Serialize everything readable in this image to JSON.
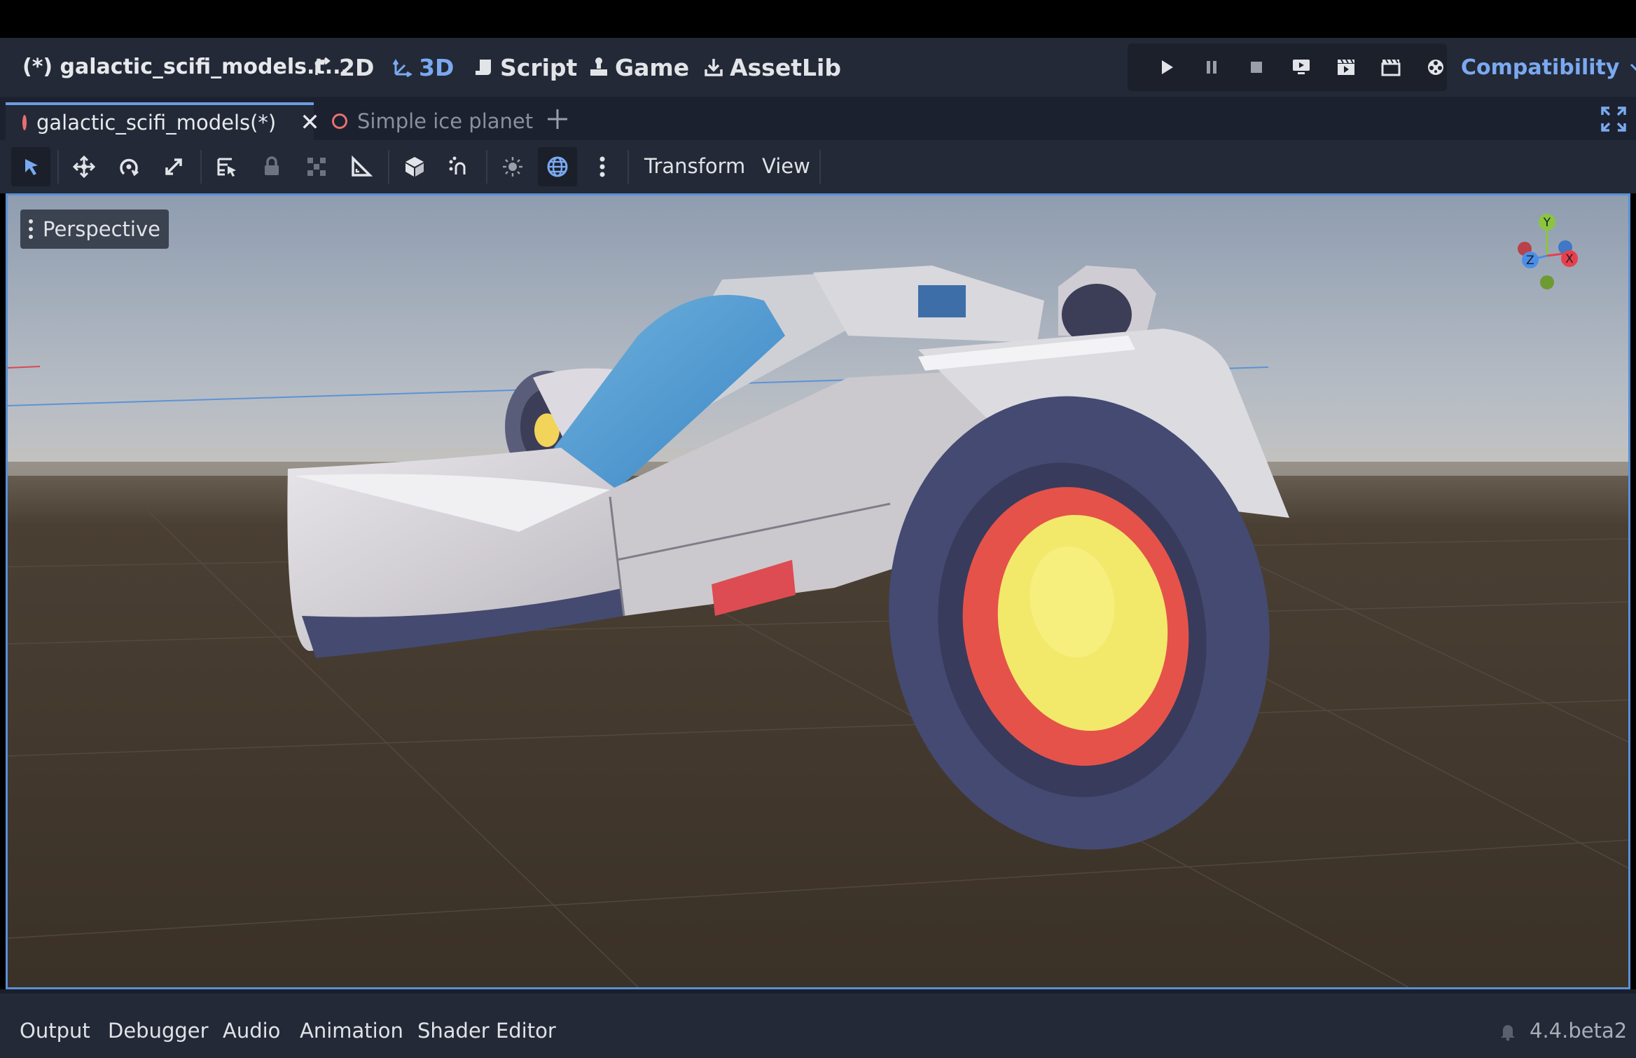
{
  "topbar": {
    "project_title": "(*) galactic_scifi_models.t...",
    "workspaces": [
      {
        "label": "2D",
        "icon": "2d-icon",
        "active": false
      },
      {
        "label": "3D",
        "icon": "3d-icon",
        "active": true
      },
      {
        "label": "Script",
        "icon": "script-icon",
        "active": false
      },
      {
        "label": "Game",
        "icon": "game-icon",
        "active": false
      },
      {
        "label": "AssetLib",
        "icon": "assetlib-icon",
        "active": false
      }
    ],
    "play_controls": [
      "play-icon",
      "pause-icon",
      "stop-icon",
      "remote-debug-icon",
      "play-scene-icon",
      "play-custom-scene-icon",
      "movie-maker-icon"
    ],
    "renderer": "Compatibility"
  },
  "scene_tabs": [
    {
      "label": "galactic_scifi_models(*)",
      "active": true
    },
    {
      "label": "Simple ice planet",
      "active": false
    }
  ],
  "toolbar": {
    "tools": [
      "select-icon",
      "move-icon",
      "rotate-icon",
      "scale-icon",
      "list-select-icon",
      "lock-icon",
      "group-icon",
      "ruler-icon",
      "local-space-icon",
      "snap-icon",
      "sun-preview-icon",
      "environment-preview-icon",
      "more-icon"
    ],
    "menus": [
      "Transform",
      "View"
    ]
  },
  "viewport": {
    "view_label": "Perspective",
    "gizmo_axes": {
      "y": "Y",
      "x": "X",
      "z": "Z"
    }
  },
  "bottom_tabs": [
    "Output",
    "Debugger",
    "Audio",
    "Animation",
    "Shader Editor"
  ],
  "version": "4.4.beta2",
  "colors": {
    "accent": "#7aa9f0",
    "panel": "#232937",
    "axis_x": "#e8404a",
    "axis_y": "#8bc53f",
    "axis_z": "#4b8ee8"
  }
}
